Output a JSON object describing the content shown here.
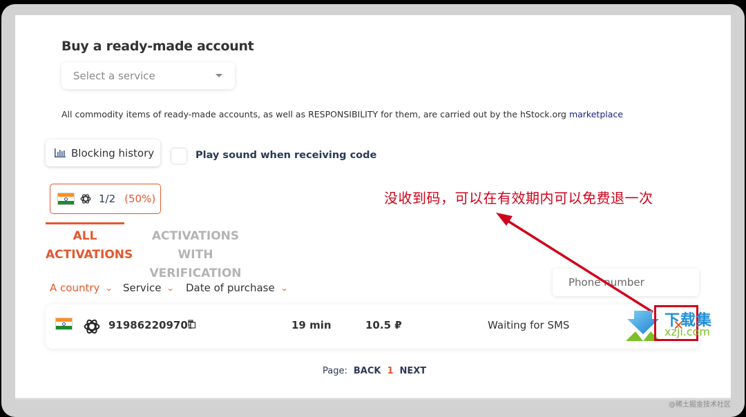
{
  "header": {
    "title": "Buy a ready-made account"
  },
  "service_select": {
    "placeholder": "Select a service"
  },
  "disclaimer": {
    "text": "All commodity items of ready-made accounts, as well as RESPONSIBILITY for them, are carried out by the hStock.org ",
    "link_label": "marketplace"
  },
  "toolbar": {
    "blocking_history_label": "Blocking history",
    "play_sound_label": "Play sound when receiving code",
    "play_sound_checked": false
  },
  "stat_chip": {
    "country_icon": "india-flag-icon",
    "service_icon": "openai-icon",
    "ratio": "1/2",
    "percent": "(50%)"
  },
  "tabs": [
    {
      "label": "ALL ACTIVATIONS",
      "active": true
    },
    {
      "label": "ACTIVATIONS WITH VERIFICATION",
      "active": false
    }
  ],
  "filters": {
    "country": "A country",
    "service": "Service",
    "date": "Date of purchase",
    "phone_placeholder": "Phone number"
  },
  "activations": [
    {
      "country_icon": "india-flag-icon",
      "service_icon": "openai-icon",
      "phone": "919862209703",
      "time_left": "19 min",
      "price": "10.5 ₽",
      "status": "Waiting for SMS",
      "cancel_icon": "close-icon"
    }
  ],
  "pagination": {
    "label": "Page:",
    "back": "BACK",
    "current": "1",
    "next": "NEXT"
  },
  "annotation": {
    "text": "没收到码，可以在有效期内可以免费退一次",
    "color": "#d0021b"
  },
  "watermark": {
    "title": "下载集",
    "domain": "xzji.com",
    "credit": "@稀土掘金技术社区"
  },
  "colors": {
    "accent": "#e4572e",
    "navy": "#2b3a55",
    "link": "#1a237e"
  }
}
